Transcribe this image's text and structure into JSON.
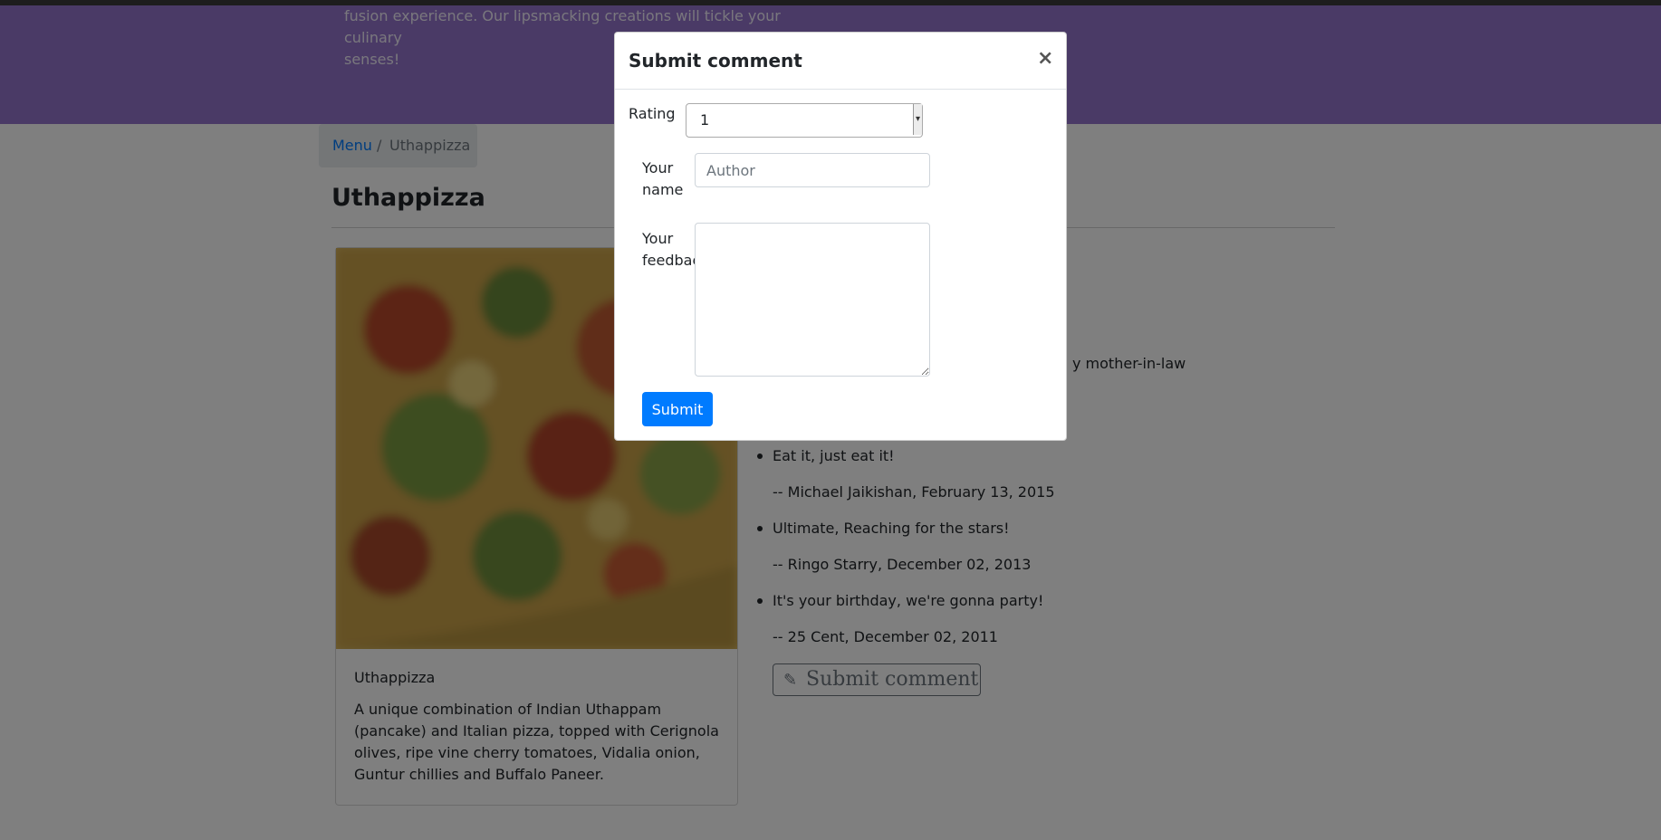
{
  "jumbotron": {
    "line1": "fusion experience. Our lipsmacking creations will tickle your culinary",
    "line2": "senses!"
  },
  "breadcrumb": {
    "menu_link": "Menu",
    "separator": "/",
    "active": "Uthappizza"
  },
  "page_title": "Uthappizza",
  "dish": {
    "name": "Uthappizza",
    "description": "A unique combination of Indian Uthappam (pancake) and Italian pizza, topped with Cerignola olives, ripe vine cherry tomatoes, Vidalia onion, Guntur chillies and Buffalo Paneer."
  },
  "comments": {
    "partial_text": "y mother-in-law",
    "items": [
      {
        "comment": "Eat it, just eat it!",
        "byline": "-- Michael Jaikishan,  February 13, 2015"
      },
      {
        "comment": "Ultimate, Reaching for the stars!",
        "byline": "-- Ringo Starry,  December 02, 2013"
      },
      {
        "comment": "It's your birthday, we're gonna party!",
        "byline": "-- 25 Cent,  December 02, 2011"
      }
    ],
    "submit_button": "Submit comment"
  },
  "modal": {
    "title": "Submit comment",
    "close": "×",
    "rating_label": "Rating",
    "rating_value": "1",
    "name_label": "Your name",
    "name_placeholder": "Author",
    "feedback_label": "Your feedback",
    "submit_label": "Submit"
  },
  "colors": {
    "jumbotron": "#9575cd",
    "primary": "#007bff",
    "link": "#007bff",
    "overlay": "rgba(0,0,0,0.5)"
  },
  "icons": {
    "close": "close-icon",
    "pencil": "pencil-icon"
  }
}
